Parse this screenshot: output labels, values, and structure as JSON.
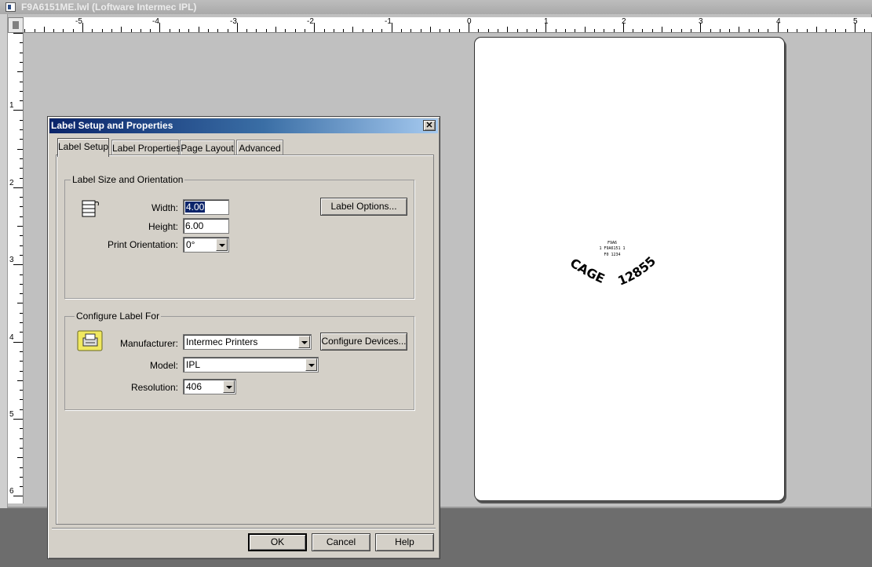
{
  "window": {
    "title": "F9A6151ME.lwl (Loftware Intermec IPL)"
  },
  "rulers": {
    "horizontal_labels": [
      "-5",
      "-4",
      "-3",
      "-2",
      "-1",
      "0",
      "1",
      "2",
      "3",
      "4",
      "5"
    ],
    "vertical_labels": [
      "1",
      "2",
      "3",
      "4",
      "5",
      "6"
    ]
  },
  "label_preview": {
    "small_lines": [
      "F9A6",
      "1 F9A6151 1",
      "F0 1234"
    ],
    "arc_text_left": "CAGE",
    "arc_text_right": "12855"
  },
  "dialog": {
    "title": "Label Setup and Properties",
    "close_glyph": "✕",
    "tabs": [
      {
        "label": "Label Setup",
        "active": true
      },
      {
        "label": "Label Properties",
        "active": false
      },
      {
        "label": "Page Layout",
        "active": false
      },
      {
        "label": "Advanced",
        "active": false
      }
    ],
    "size_group": {
      "title": "Label Size and Orientation",
      "width_label": "Width:",
      "width_value": "4.00",
      "height_label": "Height:",
      "height_value": "6.00",
      "orientation_label": "Print Orientation:",
      "orientation_value": "0°",
      "label_options_button": "Label Options..."
    },
    "configure_group": {
      "title": "Configure Label For",
      "manufacturer_label": "Manufacturer:",
      "manufacturer_value": "Intermec Printers",
      "configure_devices_button": "Configure Devices...",
      "model_label": "Model:",
      "model_value": "IPL",
      "resolution_label": "Resolution:",
      "resolution_value": "406"
    },
    "buttons": {
      "ok": "OK",
      "cancel": "Cancel",
      "help": "Help"
    }
  },
  "colors": {
    "dialog_face": "#d4d0c8",
    "title_gradient_start": "#0a246a",
    "title_gradient_end": "#a6caf0",
    "workspace": "#c0c0c0"
  }
}
